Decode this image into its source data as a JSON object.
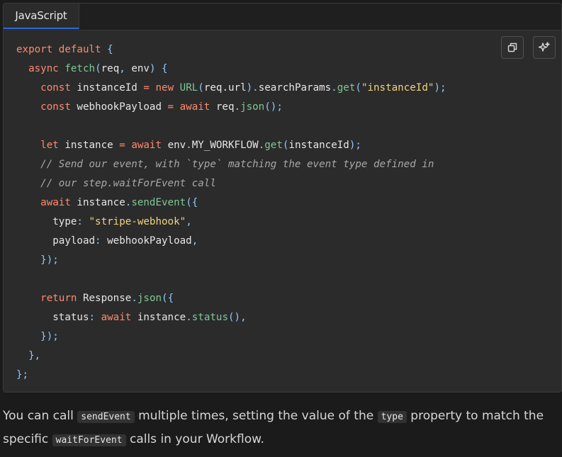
{
  "code_block": {
    "language_tab": "JavaScript",
    "copy_button_icon": "copy-icon",
    "ai_button_icon": "sparkle-icon",
    "lines": [
      [
        {
          "t": "export default ",
          "c": "kw"
        },
        {
          "t": "{",
          "c": "pu"
        }
      ],
      [
        {
          "t": "  async ",
          "c": "kw"
        },
        {
          "t": "fetch",
          "c": "fn"
        },
        {
          "t": "(",
          "c": "pu"
        },
        {
          "t": "req",
          "c": "pl"
        },
        {
          "t": ", ",
          "c": "pu"
        },
        {
          "t": "env",
          "c": "pl"
        },
        {
          "t": ") {",
          "c": "pu"
        }
      ],
      [
        {
          "t": "    const ",
          "c": "kw"
        },
        {
          "t": "instanceId ",
          "c": "pl"
        },
        {
          "t": "= ",
          "c": "kw"
        },
        {
          "t": "new ",
          "c": "kw"
        },
        {
          "t": "URL",
          "c": "fn"
        },
        {
          "t": "(",
          "c": "pu"
        },
        {
          "t": "req.url",
          "c": "pl"
        },
        {
          "t": ").",
          "c": "pu"
        },
        {
          "t": "searchParams",
          "c": "pl"
        },
        {
          "t": ".",
          "c": "pu"
        },
        {
          "t": "get",
          "c": "fn"
        },
        {
          "t": "(",
          "c": "pu"
        },
        {
          "t": "\"instanceId\"",
          "c": "str"
        },
        {
          "t": ");",
          "c": "pu"
        }
      ],
      [
        {
          "t": "    const ",
          "c": "kw"
        },
        {
          "t": "webhookPayload ",
          "c": "pl"
        },
        {
          "t": "= ",
          "c": "kw"
        },
        {
          "t": "await ",
          "c": "kw"
        },
        {
          "t": "req",
          "c": "pl"
        },
        {
          "t": ".",
          "c": "pu"
        },
        {
          "t": "json",
          "c": "fn"
        },
        {
          "t": "();",
          "c": "pu"
        }
      ],
      [],
      [
        {
          "t": "    let ",
          "c": "kw"
        },
        {
          "t": "instance ",
          "c": "pl"
        },
        {
          "t": "= ",
          "c": "kw"
        },
        {
          "t": "await ",
          "c": "kw"
        },
        {
          "t": "env",
          "c": "pl"
        },
        {
          "t": ".",
          "c": "pu"
        },
        {
          "t": "MY_WORKFLOW",
          "c": "pl"
        },
        {
          "t": ".",
          "c": "pu"
        },
        {
          "t": "get",
          "c": "fn"
        },
        {
          "t": "(",
          "c": "pu"
        },
        {
          "t": "instanceId",
          "c": "pl"
        },
        {
          "t": ");",
          "c": "pu"
        }
      ],
      [
        {
          "t": "    // Send our event, with `type` matching the event type defined in",
          "c": "cm"
        }
      ],
      [
        {
          "t": "    // our step.waitForEvent call",
          "c": "cm"
        }
      ],
      [
        {
          "t": "    await ",
          "c": "kw"
        },
        {
          "t": "instance",
          "c": "pl"
        },
        {
          "t": ".",
          "c": "pu"
        },
        {
          "t": "sendEvent",
          "c": "fn"
        },
        {
          "t": "({",
          "c": "pu"
        }
      ],
      [
        {
          "t": "      type",
          "c": "pl"
        },
        {
          "t": ": ",
          "c": "pu"
        },
        {
          "t": "\"stripe-webhook\"",
          "c": "str"
        },
        {
          "t": ",",
          "c": "pu"
        }
      ],
      [
        {
          "t": "      payload",
          "c": "pl"
        },
        {
          "t": ": ",
          "c": "pu"
        },
        {
          "t": "webhookPayload",
          "c": "pl"
        },
        {
          "t": ",",
          "c": "pu"
        }
      ],
      [
        {
          "t": "    });",
          "c": "pu"
        }
      ],
      [],
      [
        {
          "t": "    return ",
          "c": "kw"
        },
        {
          "t": "Response",
          "c": "pl"
        },
        {
          "t": ".",
          "c": "pu"
        },
        {
          "t": "json",
          "c": "fn"
        },
        {
          "t": "({",
          "c": "pu"
        }
      ],
      [
        {
          "t": "      status",
          "c": "pl"
        },
        {
          "t": ": ",
          "c": "pu"
        },
        {
          "t": "await ",
          "c": "kw"
        },
        {
          "t": "instance",
          "c": "pl"
        },
        {
          "t": ".",
          "c": "pu"
        },
        {
          "t": "status",
          "c": "fn"
        },
        {
          "t": "(),",
          "c": "pu"
        }
      ],
      [
        {
          "t": "    });",
          "c": "pu"
        }
      ],
      [
        {
          "t": "  },",
          "c": "pu"
        }
      ],
      [
        {
          "t": "};",
          "c": "pu"
        }
      ]
    ]
  },
  "prose": {
    "part1": "You can call ",
    "code1": "sendEvent",
    "part2": " multiple times, setting the value of the ",
    "code2": "type",
    "part3": " property to match the specific ",
    "code3": "waitForEvent",
    "part4": " calls in your Workflow."
  },
  "colors": {
    "keyword": "#ff8a6e",
    "function": "#7ec896",
    "string": "#f2d47e",
    "comment": "#a8a8a8",
    "tab_accent": "#2f6bd6"
  }
}
